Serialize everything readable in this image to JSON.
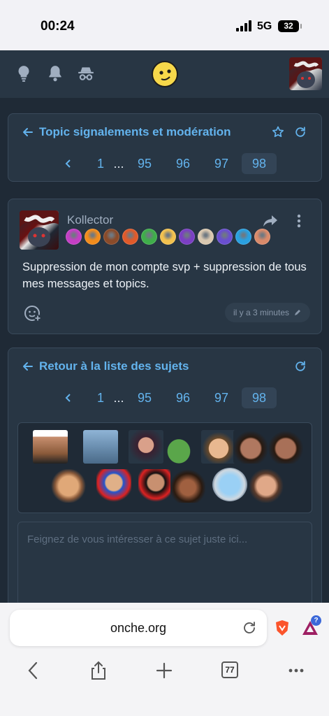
{
  "status_bar": {
    "time": "00:24",
    "network": "5G",
    "battery": "32"
  },
  "header": {
    "icons": [
      "lightbulb-icon",
      "bell-icon",
      "incognito-icon"
    ],
    "logo": "smiley-logo"
  },
  "topic_card": {
    "title": "Topic signalements et modération",
    "pages": {
      "first": "1",
      "dots": "...",
      "p1": "95",
      "p2": "96",
      "p3": "97",
      "current": "98"
    }
  },
  "post": {
    "username": "Kollector",
    "text": "Suppression de mon compte svp + suppression de tous mes messages et topics.",
    "time": "il y a 3 minutes",
    "badge_colors": [
      "#c43fc5",
      "#f28c1c",
      "#8a4b2a",
      "#e05a2a",
      "#3fae4a",
      "#f2c14e",
      "#7b3fc4",
      "#d9c8b0",
      "#6a4fd0",
      "#2aa0e0",
      "#d98a6a"
    ]
  },
  "reply_card": {
    "title": "Retour à la liste des sujets",
    "pages": {
      "first": "1",
      "dots": "...",
      "p1": "95",
      "p2": "96",
      "p3": "97",
      "current": "98"
    },
    "placeholder": "Feignez de vous intéresser à ce sujet juste ici..."
  },
  "browser": {
    "url": "onche.org",
    "tab_count": "77"
  }
}
